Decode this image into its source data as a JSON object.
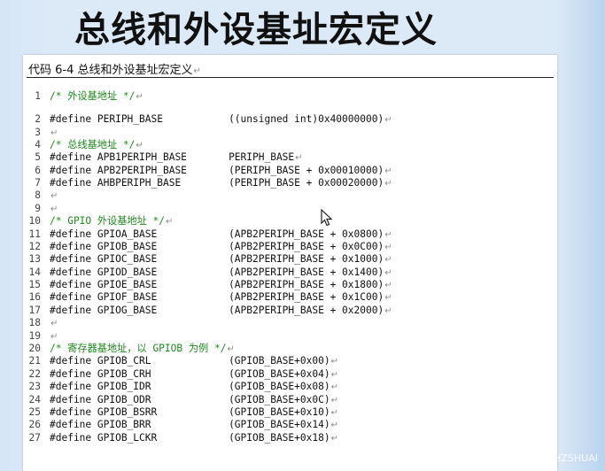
{
  "slide": {
    "title": "总线和外设基址宏定义"
  },
  "document": {
    "caption": "代码 6-4 总线和外设基址宏定义",
    "lines": [
      {
        "n": "1",
        "code": "/* 外设基地址 */",
        "comment": true
      },
      {
        "n": "2",
        "code": "#define PERIPH_BASE           ((unsigned int)0x40000000)",
        "comment": false
      },
      {
        "n": "3",
        "code": "",
        "comment": false
      },
      {
        "n": "4",
        "code": "/* 总线基地址 */",
        "comment": true
      },
      {
        "n": "5",
        "code": "#define APB1PERIPH_BASE       PERIPH_BASE",
        "comment": false
      },
      {
        "n": "6",
        "code": "#define APB2PERIPH_BASE       (PERIPH_BASE + 0x00010000)",
        "comment": false
      },
      {
        "n": "7",
        "code": "#define AHBPERIPH_BASE        (PERIPH_BASE + 0x00020000)",
        "comment": false
      },
      {
        "n": "8",
        "code": "",
        "comment": false
      },
      {
        "n": "9",
        "code": "",
        "comment": false
      },
      {
        "n": "10",
        "code": "/* GPIO 外设基地址 */",
        "comment": true
      },
      {
        "n": "11",
        "code": "#define GPIOA_BASE            (APB2PERIPH_BASE + 0x0800)",
        "comment": false
      },
      {
        "n": "12",
        "code": "#define GPIOB_BASE            (APB2PERIPH_BASE + 0x0C00)",
        "comment": false
      },
      {
        "n": "13",
        "code": "#define GPIOC_BASE            (APB2PERIPH_BASE + 0x1000)",
        "comment": false
      },
      {
        "n": "14",
        "code": "#define GPIOD_BASE            (APB2PERIPH_BASE + 0x1400)",
        "comment": false
      },
      {
        "n": "15",
        "code": "#define GPIOE_BASE            (APB2PERIPH_BASE + 0x1800)",
        "comment": false
      },
      {
        "n": "16",
        "code": "#define GPIOF_BASE            (APB2PERIPH_BASE + 0x1C00)",
        "comment": false
      },
      {
        "n": "17",
        "code": "#define GPIOG_BASE            (APB2PERIPH_BASE + 0x2000)",
        "comment": false
      },
      {
        "n": "18",
        "code": "",
        "comment": false
      },
      {
        "n": "19",
        "code": "",
        "comment": false
      },
      {
        "n": "20",
        "code": "/* 寄存器基地址，以 GPIOB 为例 */",
        "comment": true
      },
      {
        "n": "21",
        "code": "#define GPIOB_CRL             (GPIOB_BASE+0x00)",
        "comment": false
      },
      {
        "n": "22",
        "code": "#define GPIOB_CRH             (GPIOB_BASE+0x04)",
        "comment": false
      },
      {
        "n": "23",
        "code": "#define GPIOB_IDR             (GPIOB_BASE+0x08)",
        "comment": false
      },
      {
        "n": "24",
        "code": "#define GPIOB_ODR             (GPIOB_BASE+0x0C)",
        "comment": false
      },
      {
        "n": "25",
        "code": "#define GPIOB_BSRR            (GPIOB_BASE+0x10)",
        "comment": false
      },
      {
        "n": "26",
        "code": "#define GPIOB_BRR             (GPIOB_BASE+0x14)",
        "comment": false
      },
      {
        "n": "27",
        "code": "#define GPIOB_LCKR            (GPIOB_BASE+0x18)",
        "comment": false
      }
    ]
  },
  "watermark": "https://blog.csdn.net/JHZSHUAI",
  "icons": {
    "pilcrow": "↵",
    "cursor": "mouse-pointer-icon"
  }
}
